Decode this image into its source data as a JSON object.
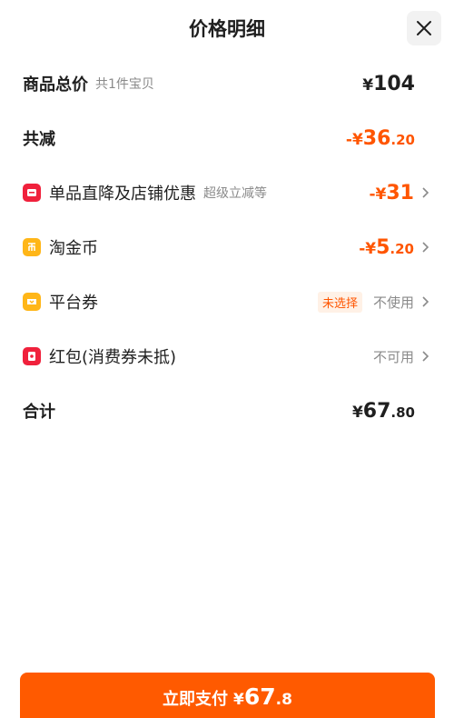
{
  "header": {
    "title": "价格明细",
    "close_icon": "close-icon"
  },
  "rows": {
    "total": {
      "label": "商品总价",
      "sub": "共1件宝贝",
      "currency": "¥",
      "amount": "104"
    },
    "reduction": {
      "label": "共减",
      "prefix": "-¥",
      "amount_int": "36",
      "amount_dec": ".20"
    },
    "store_discount": {
      "icon": "store-icon",
      "label": "单品直降及店铺优惠",
      "sub": "超级立减等",
      "prefix": "-¥",
      "amount_int": "31"
    },
    "gold_coin": {
      "icon": "coin-icon",
      "label": "淘金币",
      "prefix": "-¥",
      "amount_int": "5",
      "amount_dec": ".20"
    },
    "platform_coupon": {
      "icon": "coupon-icon",
      "label": "平台券",
      "tag": "未选择",
      "status": "不使用"
    },
    "red_packet": {
      "icon": "red-packet-icon",
      "label": "红包(消费券未抵)",
      "status": "不可用"
    },
    "sum": {
      "label": "合计",
      "currency": "¥",
      "amount_int": "67",
      "amount_dec": ".80"
    }
  },
  "pay_button": {
    "label": "立即支付",
    "currency": "¥",
    "amount_int": "67",
    "amount_dec": ".8"
  },
  "colors": {
    "accent": "#ff5500",
    "button": "#ff5a00",
    "icon_red": "#f0213c",
    "icon_yellow": "#ffb618"
  }
}
